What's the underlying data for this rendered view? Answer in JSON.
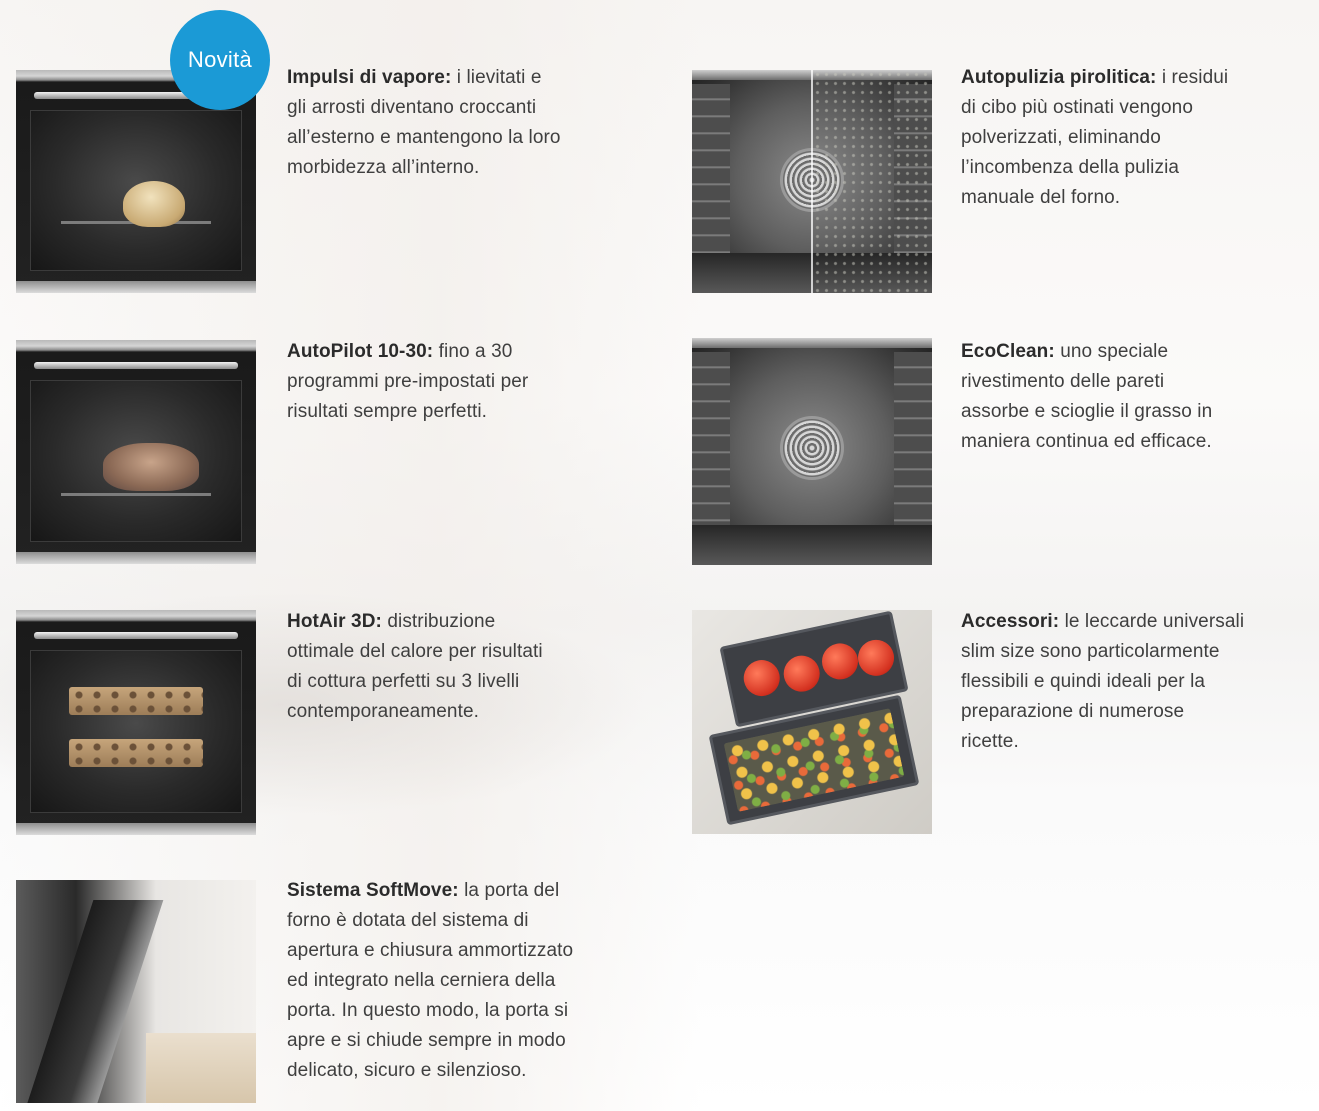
{
  "badge": {
    "text": "Novità",
    "color": "#1b9ad6"
  },
  "features": {
    "steam": {
      "title": "Impulsi di vapore:",
      "lines": [
        "i lievitati e",
        "gli arrosti diventano croccanti",
        "all’esterno e mantengono la loro",
        "morbidezza all’interno."
      ],
      "image": "oven-with-bread-image"
    },
    "pyrolytic": {
      "title": "Autopulizia pirolitica:",
      "lines": [
        "i residui",
        "di cibo più ostinati vengono",
        "polverizzati, eliminando",
        "l’incombenza della pulizia",
        "manuale del forno."
      ],
      "image": "oven-interior-split-image"
    },
    "autopilot": {
      "title": "AutoPilot 10-30:",
      "lines": [
        "fino a 30",
        "programmi pre-impostati per",
        "risultati sempre perfetti."
      ],
      "image": "oven-with-roast-image"
    },
    "ecoclean": {
      "title": "EcoClean:",
      "lines": [
        "uno speciale",
        "rivestimento delle pareti",
        "assorbe e scioglie il grasso in",
        "maniera continua ed efficace."
      ],
      "image": "oven-interior-image"
    },
    "hotair": {
      "title": "HotAir 3D:",
      "lines": [
        "distribuzione",
        "ottimale del calore per risultati",
        "di cottura perfetti su 3 livelli",
        "contemporaneamente."
      ],
      "image": "oven-with-trays-image"
    },
    "accessories": {
      "title": "Accessori:",
      "lines": [
        "le leccarde universali",
        "slim size sono particolarmente",
        "flessibili e quindi ideali per la",
        "preparazione di numerose",
        "ricette."
      ],
      "image": "baking-trays-image"
    },
    "softmove": {
      "title": "Sistema SoftMove:",
      "lines": [
        "la porta del",
        "forno è dotata del sistema di",
        "apertura e chiusura  ammortizzato",
        "ed integrato nella cerniera della",
        "porta. In questo modo, la porta si",
        "apre e si chiude sempre in modo",
        "delicato, sicuro e silenzioso."
      ],
      "image": "oven-door-opening-image"
    }
  }
}
